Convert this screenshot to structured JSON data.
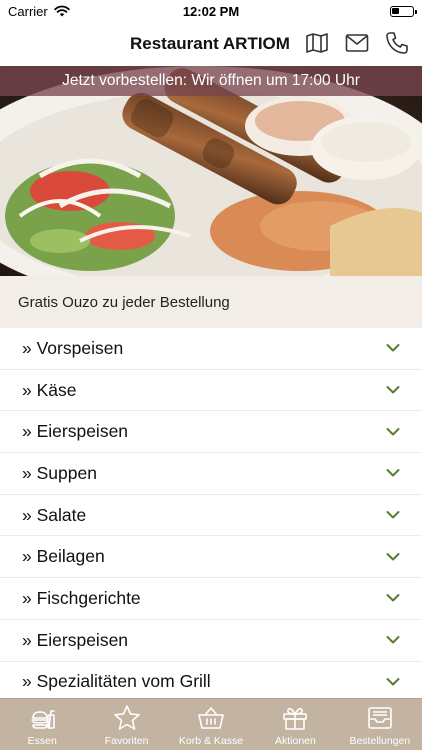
{
  "status_bar": {
    "carrier": "Carrier",
    "time": "12:02 PM"
  },
  "header": {
    "title": "Restaurant ARTIOM",
    "icons": [
      "map-icon",
      "mail-icon",
      "phone-icon"
    ]
  },
  "hero": {
    "banner": "Jetzt vorbestellen: Wir öffnen um 17:00 Uhr"
  },
  "promo": {
    "text": "Gratis Ouzo zu jeder Bestellung"
  },
  "menu": {
    "items": [
      {
        "label": "» Vorspeisen"
      },
      {
        "label": "» Käse"
      },
      {
        "label": "» Eierspeisen"
      },
      {
        "label": "» Suppen"
      },
      {
        "label": "» Salate"
      },
      {
        "label": "» Beilagen"
      },
      {
        "label": "» Fischgerichte"
      },
      {
        "label": "» Eierspeisen"
      },
      {
        "label": "» Spezialitäten vom Grill"
      }
    ]
  },
  "tabs": [
    {
      "label": "Essen",
      "icon": "food-icon"
    },
    {
      "label": "Favoriten",
      "icon": "star-icon"
    },
    {
      "label": "Korb & Kasse",
      "icon": "basket-icon"
    },
    {
      "label": "Aktionen",
      "icon": "gift-icon"
    },
    {
      "label": "Bestellungen",
      "icon": "inbox-icon"
    }
  ],
  "colors": {
    "accent": "#5a7d2a",
    "tab_bar": "#c3b4a1",
    "promo_bg": "#f2ede6",
    "banner": "#784650"
  }
}
